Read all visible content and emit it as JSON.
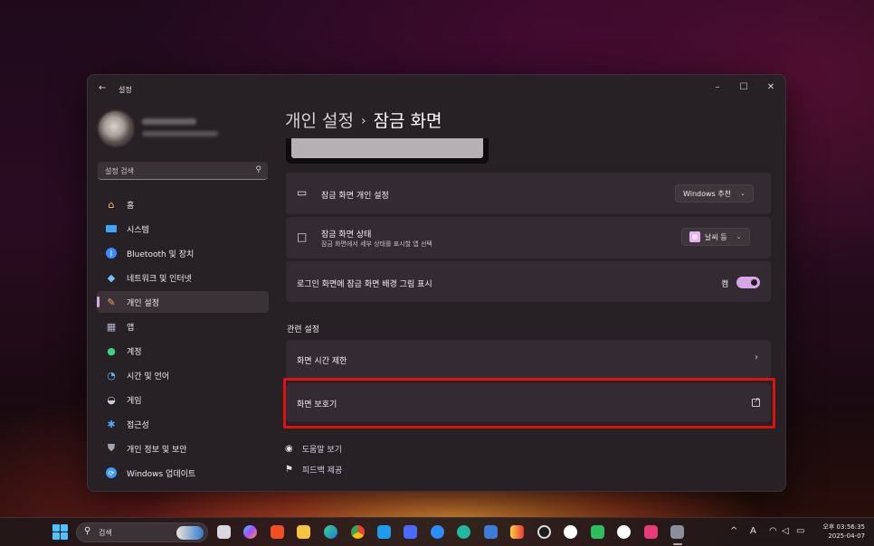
{
  "window": {
    "app_title": "설정",
    "back_icon": "back-arrow-icon",
    "controls": {
      "minimize": "–",
      "maximize": "☐",
      "close": "✕"
    }
  },
  "sidebar": {
    "search": {
      "placeholder": "설정 검색",
      "icon": "search-icon"
    },
    "items": [
      {
        "label": "홈",
        "icon": "home-icon",
        "color": "#f2c46b"
      },
      {
        "label": "시스템",
        "icon": "monitor-icon",
        "color": "#3fa6ff"
      },
      {
        "label": "Bluetooth 및 장치",
        "icon": "bluetooth-icon",
        "color": "#3a8cff"
      },
      {
        "label": "네트워크 및 인터넷",
        "icon": "wifi-icon",
        "color": "#6ec4ff"
      },
      {
        "label": "개인 설정",
        "icon": "brush-icon",
        "color": "#f0a65a",
        "active": true
      },
      {
        "label": "앱",
        "icon": "apps-icon",
        "color": "#b0b6c8"
      },
      {
        "label": "계정",
        "icon": "account-icon",
        "color": "#3fd08a"
      },
      {
        "label": "시간 및 언어",
        "icon": "globe-clock-icon",
        "color": "#55b8ff"
      },
      {
        "label": "게임",
        "icon": "gamepad-icon",
        "color": "#c8ccd8"
      },
      {
        "label": "접근성",
        "icon": "accessibility-icon",
        "color": "#4aa8ff"
      },
      {
        "label": "개인 정보 및 보안",
        "icon": "shield-icon",
        "color": "#a0a6b4"
      },
      {
        "label": "Windows 업데이트",
        "icon": "update-icon",
        "color": "#3a9cff"
      }
    ]
  },
  "main": {
    "breadcrumb": {
      "parent": "개인 설정",
      "separator": "›",
      "current": "잠금 화면"
    },
    "cards": {
      "personalize": {
        "title": "잠금 화면 개인 설정",
        "icon": "lock-screen-icon",
        "dropdown_value": "Windows 추천"
      },
      "status": {
        "title": "잠금 화면 상태",
        "subtitle": "잠금 화면에서 세부 상태를 표시할 앱 선택",
        "icon": "status-app-icon",
        "dropdown_value": "날씨 등"
      },
      "show_background": {
        "label": "로그인 화면에 잠금 화면 배경 그림 표시",
        "toggle_label": "켬",
        "toggle_on": true
      }
    },
    "related": {
      "title": "관련 설정",
      "items": [
        {
          "label": "화면 시간 제한",
          "icon": "chevron-right-icon"
        },
        {
          "label": "화면 보호기",
          "icon": "external-link-icon"
        }
      ]
    },
    "help": [
      {
        "label": "도움말 보기",
        "icon": "help-icon"
      },
      {
        "label": "피드백 제공",
        "icon": "feedback-icon"
      }
    ]
  },
  "taskbar": {
    "search_label": "검색",
    "apps": [
      "widgets",
      "copilot",
      "store",
      "file-explorer",
      "edge",
      "chrome",
      "twitter",
      "messenger",
      "zoom",
      "perplexity",
      "todo",
      "vivaldi",
      "obs",
      "sync",
      "evernote",
      "chatgpt",
      "photo",
      "settings"
    ],
    "tray": {
      "chevron": "^",
      "ime": "A",
      "wifi": "wifi-icon",
      "speaker": "speaker-icon",
      "battery": "battery-icon"
    },
    "clock": {
      "time": "오후 03:56:35",
      "date": "2025-04-07"
    }
  }
}
